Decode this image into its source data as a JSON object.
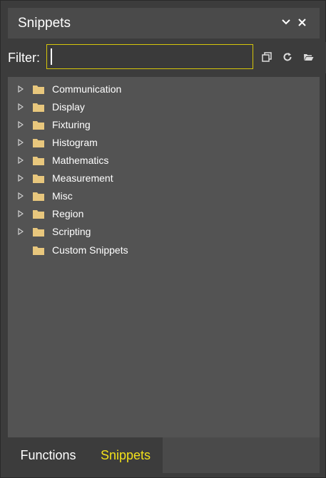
{
  "panel": {
    "title": "Snippets",
    "collapse_icon": "chevron-down-icon",
    "close_icon": "close-icon"
  },
  "filter": {
    "label": "Filter:",
    "value": "",
    "placeholder": "",
    "icons": [
      "copy-icon",
      "refresh-icon",
      "open-folder-icon"
    ]
  },
  "tree": {
    "items": [
      {
        "label": "Communication",
        "expandable": true
      },
      {
        "label": "Display",
        "expandable": true
      },
      {
        "label": "Fixturing",
        "expandable": true
      },
      {
        "label": "Histogram",
        "expandable": true
      },
      {
        "label": "Mathematics",
        "expandable": true
      },
      {
        "label": "Measurement",
        "expandable": true
      },
      {
        "label": "Misc",
        "expandable": true
      },
      {
        "label": "Region",
        "expandable": true
      },
      {
        "label": "Scripting",
        "expandable": true
      },
      {
        "label": "Custom Snippets",
        "expandable": false
      }
    ]
  },
  "tabs": [
    {
      "label": "Functions",
      "active": false
    },
    {
      "label": "Snippets",
      "active": true
    }
  ],
  "colors": {
    "accent": "#f2e01a",
    "folder": "#e8c77d",
    "panel_bg": "#3c3c3c",
    "tree_bg": "#535353"
  }
}
